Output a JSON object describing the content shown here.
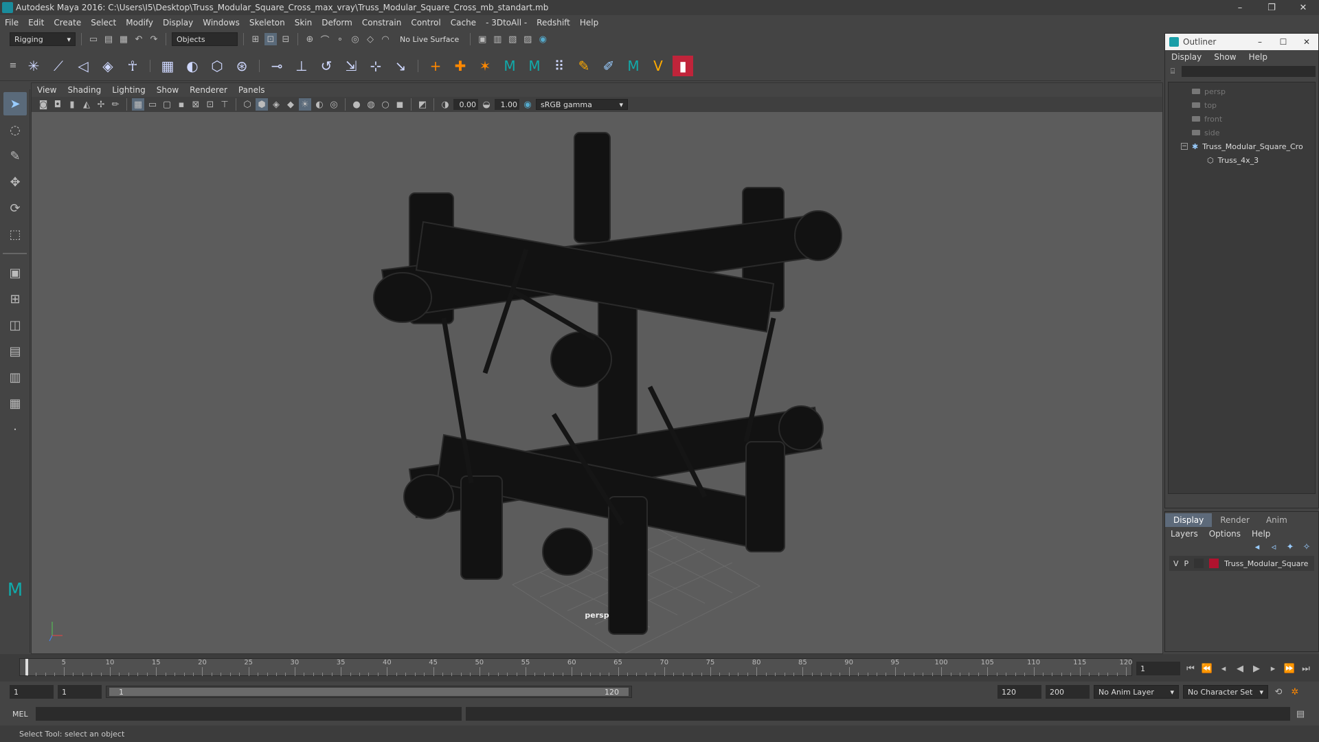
{
  "window": {
    "title": "Autodesk Maya 2016: C:\\Users\\I5\\Desktop\\Truss_Modular_Square_Cross_max_vray\\Truss_Modular_Square_Cross_mb_standart.mb",
    "min": "–",
    "max": "❐",
    "close": "✕"
  },
  "menubar": [
    "File",
    "Edit",
    "Create",
    "Select",
    "Modify",
    "Display",
    "Windows",
    "Skeleton",
    "Skin",
    "Deform",
    "Constrain",
    "Control",
    "Cache",
    "- 3DtoAll -",
    "Redshift",
    "Help"
  ],
  "status": {
    "mode": "Rigging",
    "objects": "Objects",
    "live": "No Live Surface"
  },
  "viewport": {
    "menu": [
      "View",
      "Shading",
      "Lighting",
      "Show",
      "Renderer",
      "Panels"
    ],
    "exposure": "0.00",
    "gamma_value": "1.00",
    "colorspace": "sRGB gamma",
    "camera": "persp"
  },
  "outliner": {
    "title": "Outliner",
    "min": "–",
    "max": "☐",
    "close": "✕",
    "menu": [
      "Display",
      "Show",
      "Help"
    ],
    "items": [
      {
        "label": "persp",
        "dim": true
      },
      {
        "label": "top",
        "dim": true
      },
      {
        "label": "front",
        "dim": true
      },
      {
        "label": "side",
        "dim": true
      },
      {
        "label": "Truss_Modular_Square_Cro",
        "dim": false
      },
      {
        "label": "Truss_4x_3",
        "dim": false
      }
    ]
  },
  "layers": {
    "tabs": [
      "Display",
      "Render",
      "Anim"
    ],
    "menu": [
      "Layers",
      "Options",
      "Help"
    ],
    "row": {
      "v": "V",
      "p": "P",
      "name": "Truss_Modular_Square",
      "color": "#b0122e"
    }
  },
  "timeline": {
    "ticks": [
      "5",
      "10",
      "15",
      "20",
      "25",
      "30",
      "35",
      "40",
      "45",
      "50",
      "55",
      "60",
      "65",
      "70",
      "75",
      "80",
      "85",
      "90",
      "95",
      "100",
      "105",
      "110",
      "115",
      "120"
    ],
    "current": "1"
  },
  "range": {
    "start": "1",
    "playstart": "1",
    "slider_start": "1",
    "slider_end": "120",
    "end": "120",
    "max": "200",
    "anim_layer": "No Anim Layer",
    "char_set": "No Character Set"
  },
  "mel": {
    "label": "MEL"
  },
  "help": {
    "text": "Select Tool: select an object"
  }
}
